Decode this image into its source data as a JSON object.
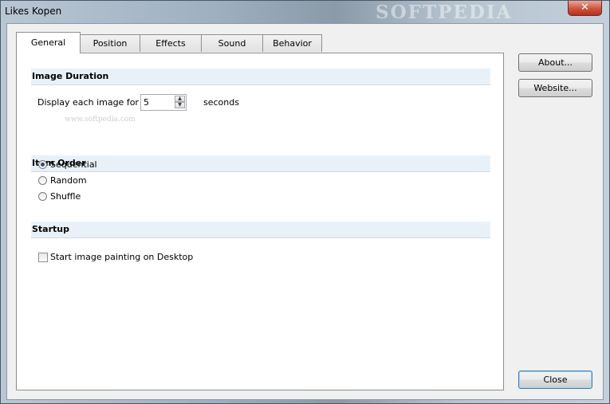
{
  "window": {
    "title": "Likes Kopen",
    "close_glyph": "✕",
    "watermark": "SOFTPEDIA"
  },
  "tabs": [
    {
      "label": "General",
      "active": true
    },
    {
      "label": "Position",
      "active": false
    },
    {
      "label": "Effects",
      "active": false
    },
    {
      "label": "Sound",
      "active": false
    },
    {
      "label": "Behavior",
      "active": false
    }
  ],
  "image_duration": {
    "heading": "Image Duration",
    "label": "Display each image for",
    "value": "5",
    "unit": "seconds"
  },
  "item_order": {
    "heading": "Item Order",
    "options": [
      {
        "label": "Sequential",
        "selected": true
      },
      {
        "label": "Random",
        "selected": false
      },
      {
        "label": "Shuffle",
        "selected": false
      }
    ]
  },
  "startup": {
    "heading": "Startup",
    "checkbox_label": "Start image painting on Desktop",
    "checked": false
  },
  "panel_watermark": "www.softpedia.com",
  "buttons": {
    "about": "About...",
    "website": "Website...",
    "close": "Close"
  },
  "colors": {
    "section_bg": "#e9f1f8",
    "default_button_border": "#3c7fb1"
  }
}
